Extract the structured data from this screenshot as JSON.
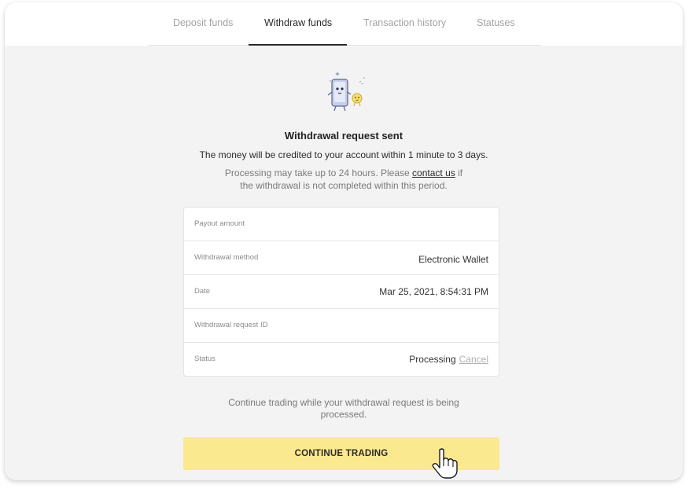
{
  "tabs": [
    {
      "label": "Deposit funds",
      "active": false
    },
    {
      "label": "Withdraw funds",
      "active": true
    },
    {
      "label": "Transaction history",
      "active": false
    },
    {
      "label": "Statuses",
      "active": false
    }
  ],
  "illustration": {
    "icon": "wallet-mascot-icon"
  },
  "message": {
    "title": "Withdrawal request sent",
    "credited": "The money will be credited to your account within 1 minute to 3 days.",
    "processing_pre": "Processing may take up to 24 hours. Please ",
    "contact_link": "contact us",
    "processing_post": " if the withdrawal is not completed within this period."
  },
  "details": {
    "payout_amount": {
      "label": "Payout amount",
      "value": ""
    },
    "method": {
      "label": "Withdrawal method",
      "value": "Electronic Wallet"
    },
    "date": {
      "label": "Date",
      "value": "Mar 25, 2021, 8:54:31 PM"
    },
    "request_id": {
      "label": "Withdrawal request ID",
      "value": ""
    },
    "status": {
      "label": "Status",
      "value": "Processing",
      "cancel": "Cancel"
    }
  },
  "footer": {
    "continue_note": "Continue trading while your withdrawal request is being processed.",
    "cta_label": "CONTINUE TRADING"
  },
  "colors": {
    "accent_button": "#fbe98f",
    "background": "#f3f3f3",
    "active_tab": "#2a2a2a"
  }
}
